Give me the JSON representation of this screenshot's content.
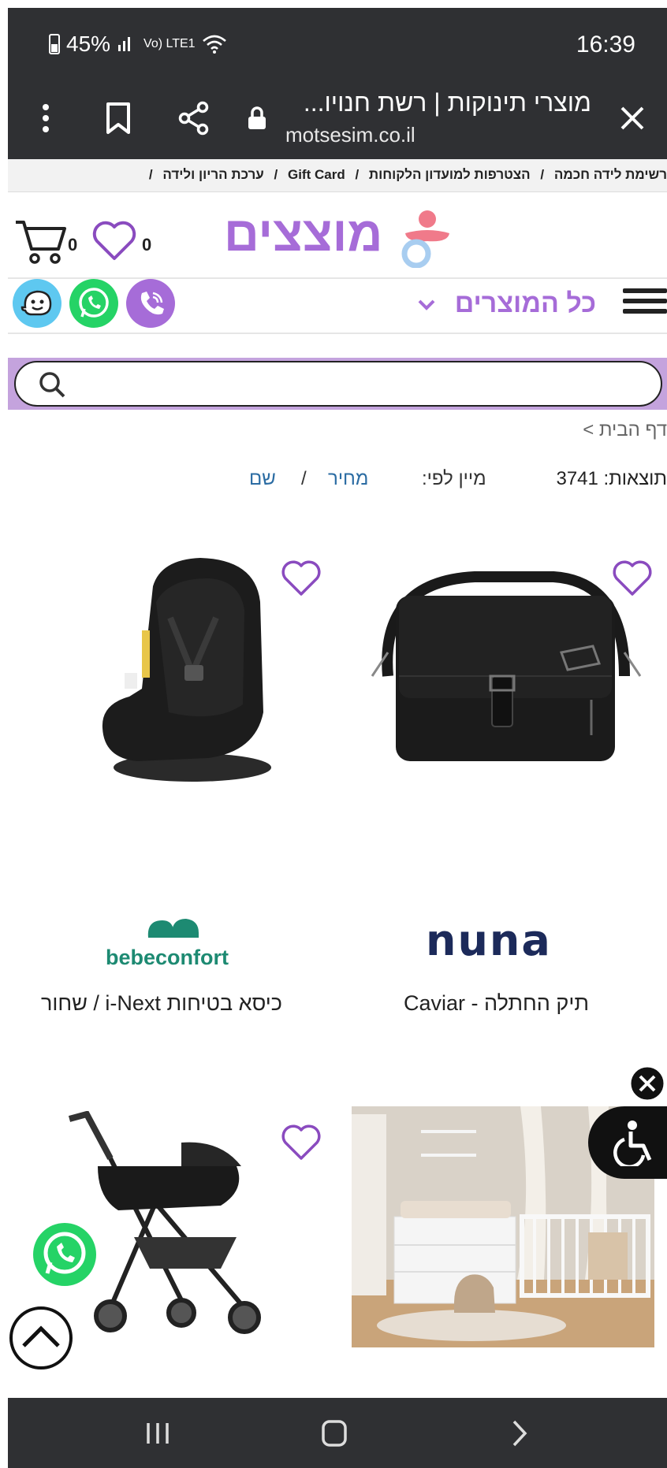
{
  "status_bar": {
    "battery": "45%",
    "signal_text": "Vo) LTE1",
    "time": "16:39"
  },
  "browser": {
    "page_title": "מוצרי תינוקות | רשת חנויו...",
    "url": "motsesim.co.il"
  },
  "top_links": [
    "רשימת לידה חכמה",
    "/",
    "הצטרפות למועדון הלקוחות",
    "/",
    "Gift Card",
    "/",
    "ערכת הריון ולידה",
    "/"
  ],
  "header": {
    "logo_text": "מוצצים",
    "cart_count": "0",
    "wishlist_count": "0"
  },
  "menu": {
    "label": "כל המוצרים"
  },
  "search": {
    "placeholder": ""
  },
  "breadcrumb": "דף הבית >",
  "listing": {
    "results_text": "תוצאות: 3741",
    "sort_label": "מיין לפי:",
    "sort_price": "מחיר",
    "sort_separator": "/",
    "sort_name": "שם"
  },
  "products": [
    {
      "brand": "nuna",
      "name": "תיק החתלה - Caviar"
    },
    {
      "brand": "bebeconfort",
      "name": "כיסא בטיחות i-Next / שחור"
    }
  ],
  "colors": {
    "brand_purple": "#a66cd8",
    "link_blue": "#2b6ca3",
    "dark_bar": "#2f3033",
    "whatsapp_green": "#25d366",
    "viber_purple": "#a66cd8",
    "waze_blue": "#5ec8f0"
  }
}
